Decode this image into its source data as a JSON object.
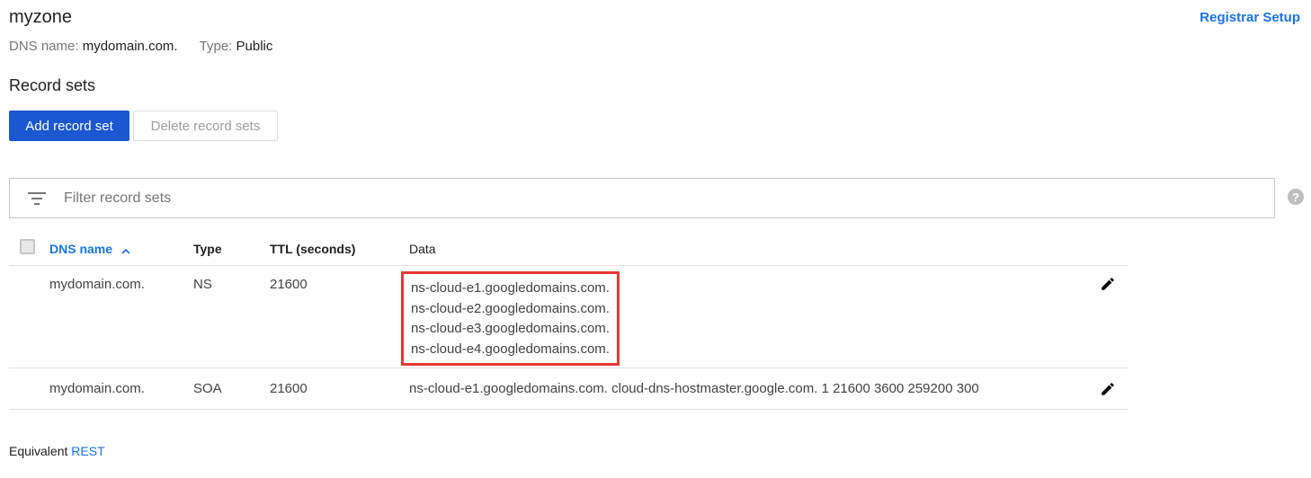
{
  "zone": {
    "title": "myzone",
    "dns_name_label": "DNS name:",
    "dns_name_value": "mydomain.com.",
    "type_label": "Type:",
    "type_value": "Public"
  },
  "header": {
    "registrar_link": "Registrar Setup"
  },
  "record_sets": {
    "title": "Record sets",
    "add_button": "Add record set",
    "delete_button": "Delete record sets"
  },
  "filter": {
    "placeholder": "Filter record sets",
    "value": ""
  },
  "table": {
    "columns": {
      "dns_name": "DNS name",
      "sort_indicator": "^",
      "type": "Type",
      "ttl": "TTL (seconds)",
      "data": "Data"
    },
    "rows": [
      {
        "dns_name": "mydomain.com.",
        "type": "NS",
        "ttl": "21600",
        "data": [
          "ns-cloud-e1.googledomains.com.",
          "ns-cloud-e2.googledomains.com.",
          "ns-cloud-e3.googledomains.com.",
          "ns-cloud-e4.googledomains.com."
        ]
      },
      {
        "dns_name": "mydomain.com.",
        "type": "SOA",
        "ttl": "21600",
        "data": "ns-cloud-e1.googledomains.com. cloud-dns-hostmaster.google.com. 1 21600 3600 259200 300"
      }
    ]
  },
  "footer": {
    "label": "Equivalent",
    "link": "REST"
  },
  "colors": {
    "primary": "#1a57d0",
    "link": "#1a73e8",
    "highlight": "#e53935"
  },
  "icons": [
    "filter-icon",
    "help-icon",
    "chevron-up-icon",
    "edit-icon"
  ]
}
